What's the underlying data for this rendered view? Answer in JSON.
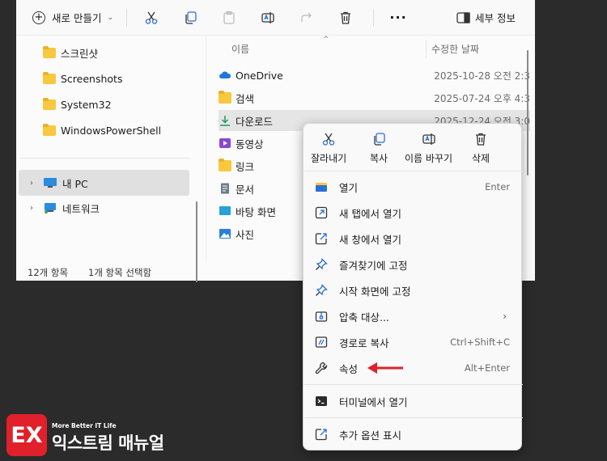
{
  "toolbar": {
    "new_label": "새로 만들기",
    "details_label": "세부 정보",
    "more_label": "···"
  },
  "nav": {
    "folders": [
      {
        "label": "스크린샷"
      },
      {
        "label": "Screenshots"
      },
      {
        "label": "System32"
      },
      {
        "label": "WindowsPowerShell"
      }
    ],
    "this_pc": "내 PC",
    "network": "네트워크"
  },
  "content": {
    "col_name": "이름",
    "col_date": "수정한 날짜",
    "rows": [
      {
        "name": "OneDrive",
        "date": "2025-10-28 오전 2:3",
        "icon": "cloud-icon"
      },
      {
        "name": "검색",
        "date": "2025-07-24 오후 4:3",
        "icon": "folder-icon"
      },
      {
        "name": "다운로드",
        "date": "2025-12-24 오전 3:0",
        "icon": "download-icon"
      },
      {
        "name": "동영상",
        "date": "",
        "icon": "video-icon"
      },
      {
        "name": "링크",
        "date": "",
        "icon": "folder-icon"
      },
      {
        "name": "문서",
        "date": "",
        "icon": "document-icon"
      },
      {
        "name": "바탕 화면",
        "date": "",
        "icon": "desktop-icon"
      },
      {
        "name": "사진",
        "date": "",
        "icon": "picture-icon"
      }
    ]
  },
  "status": {
    "count": "12개 항목",
    "selected": "1개 항목 선택함"
  },
  "context_menu": {
    "actions": [
      {
        "label": "잘라내기",
        "icon": "scissors-icon"
      },
      {
        "label": "복사",
        "icon": "copy-icon"
      },
      {
        "label": "이름 바꾸기",
        "icon": "rename-icon"
      },
      {
        "label": "삭제",
        "icon": "trash-icon"
      }
    ],
    "items": [
      {
        "label": "열기",
        "shortcut": "Enter",
        "icon": "open-folder-icon"
      },
      {
        "label": "새 탭에서 열기",
        "shortcut": "",
        "icon": "new-tab-icon"
      },
      {
        "label": "새 창에서 열기",
        "shortcut": "",
        "icon": "new-window-icon"
      },
      {
        "label": "즐겨찾기에 고정",
        "shortcut": "",
        "icon": "pin-icon"
      },
      {
        "label": "시작 화면에 고정",
        "shortcut": "",
        "icon": "pin-icon"
      },
      {
        "label": "압축 대상...",
        "shortcut": "",
        "icon": "zip-icon",
        "submenu": "›"
      },
      {
        "label": "경로로 복사",
        "shortcut": "Ctrl+Shift+C",
        "icon": "copy-path-icon"
      },
      {
        "label": "속성",
        "shortcut": "Alt+Enter",
        "icon": "wrench-icon"
      },
      {
        "label": "터미널에서 열기",
        "shortcut": "",
        "icon": "terminal-icon"
      },
      {
        "label": "추가 옵션 표시",
        "shortcut": "",
        "icon": "more-options-icon"
      }
    ]
  },
  "logo": {
    "mark": "EX",
    "tagline": "More Better IT Life",
    "name": "익스트림 매뉴얼"
  },
  "colors": {
    "accent_red": "#e0202a",
    "folder_yellow": "#f8c83e",
    "selection": "#e0e0e0"
  }
}
